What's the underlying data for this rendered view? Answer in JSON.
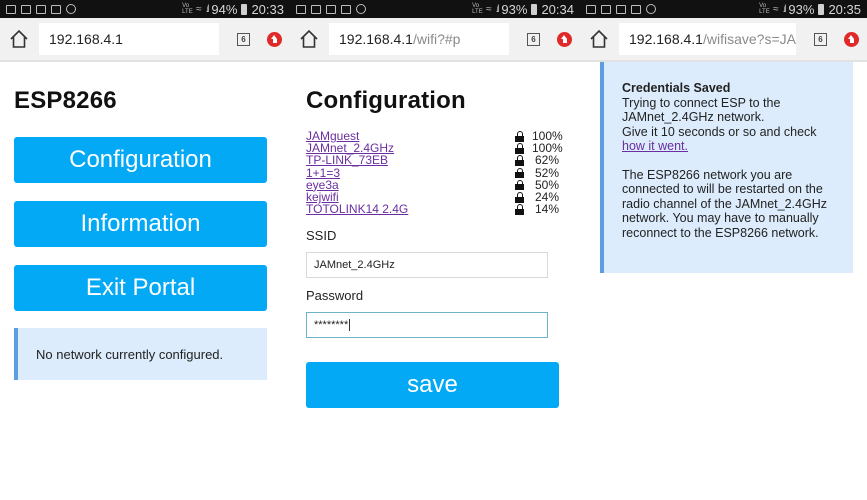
{
  "colors": {
    "button": "#03a9f4",
    "message_bg": "#dcecfc",
    "message_border": "#5c9edf",
    "link_visited": "#6a2fa0",
    "statusbar_bg": "#111111"
  },
  "screens": [
    {
      "status": {
        "battery": "94%",
        "time": "20:33"
      },
      "url": {
        "host": "192.168.4.1",
        "path": ""
      },
      "tab_count": "6",
      "title": "ESP8266",
      "buttons": [
        "Configuration",
        "Information",
        "Exit Portal"
      ],
      "message": "No network currently configured."
    },
    {
      "status": {
        "battery": "93%",
        "time": "20:34"
      },
      "url": {
        "host": "192.168.4.1",
        "path": "/wifi?#p"
      },
      "tab_count": "6",
      "title": "Configuration",
      "networks": [
        {
          "ssid": "JAMguest",
          "signal": "100%",
          "locked": true
        },
        {
          "ssid": "JAMnet_2.4GHz",
          "signal": "100%",
          "locked": true
        },
        {
          "ssid": "TP-LINK_73EB",
          "signal": "62%",
          "locked": true
        },
        {
          "ssid": "1+1=3",
          "signal": "52%",
          "locked": true
        },
        {
          "ssid": "eye3a",
          "signal": "50%",
          "locked": true
        },
        {
          "ssid": "kejwifi",
          "signal": "24%",
          "locked": true
        },
        {
          "ssid": "TOTOLINK14 2.4G",
          "signal": "14%",
          "locked": true
        }
      ],
      "ssid_label": "SSID",
      "ssid_value": "JAMnet_2.4GHz",
      "password_label": "Password",
      "password_value": "********",
      "save_label": "save"
    },
    {
      "status": {
        "battery": "93%",
        "time": "20:35"
      },
      "url": {
        "host": "192.168.4.1",
        "path": "/wifisave?s=JAN"
      },
      "tab_count": "6",
      "heading": "Credentials Saved",
      "line1": "Trying to connect ESP to the",
      "line2": "JAMnet_2.4GHz network.",
      "line3": "Give it 10 seconds or so and check",
      "link": "how it went.",
      "para2": "The ESP8266 network you are connected to will be restarted on the radio channel of the JAMnet_2.4GHz network. You may have to manually reconnect to the ESP8266 network."
    }
  ]
}
